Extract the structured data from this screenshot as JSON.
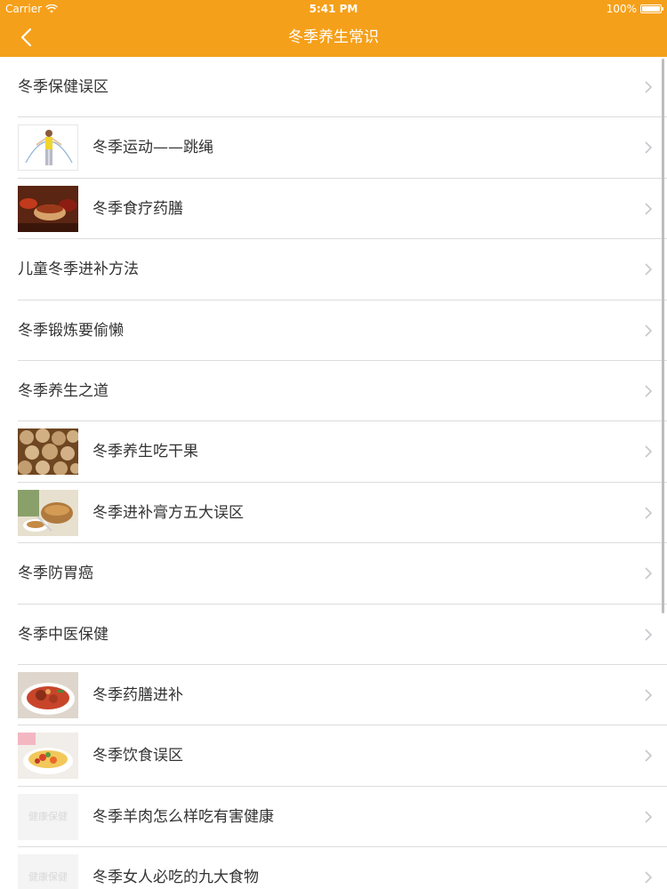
{
  "status_bar": {
    "carrier": "Carrier",
    "time": "5:41 PM",
    "battery": "100%"
  },
  "nav": {
    "title": "冬季养生常识",
    "back_icon": "chevron-left-icon"
  },
  "colors": {
    "accent": "#f5a01a",
    "text": "#333333",
    "separator": "#dcdcdc",
    "chevron": "#c7c7cc"
  },
  "list": {
    "items": [
      {
        "label": "冬季保健误区",
        "has_image": false
      },
      {
        "label": "冬季运动——跳绳",
        "has_image": true,
        "image": "jump-rope-photo"
      },
      {
        "label": "冬季食疗药膳",
        "has_image": true,
        "image": "medicinal-food-photo"
      },
      {
        "label": "儿童冬季进补方法",
        "has_image": false
      },
      {
        "label": "冬季锻炼要偷懒",
        "has_image": false
      },
      {
        "label": "冬季养生之道",
        "has_image": false
      },
      {
        "label": "冬季养生吃干果",
        "has_image": true,
        "image": "nuts-photo"
      },
      {
        "label": "冬季进补膏方五大误区",
        "has_image": true,
        "image": "herbal-paste-photo"
      },
      {
        "label": "冬季防胃癌",
        "has_image": false
      },
      {
        "label": "冬季中医保健",
        "has_image": false
      },
      {
        "label": "冬季药膳进补",
        "has_image": true,
        "image": "soup-photo"
      },
      {
        "label": "冬季饮食误区",
        "has_image": true,
        "image": "food-bowl-photo"
      },
      {
        "label": "冬季羊肉怎么样吃有害健康",
        "has_image": true,
        "image": "placeholder-image",
        "placeholder_text": "健康保健"
      },
      {
        "label": "冬季女人必吃的九大食物",
        "has_image": true,
        "image": "placeholder-image",
        "placeholder_text": "健康保健"
      }
    ]
  }
}
